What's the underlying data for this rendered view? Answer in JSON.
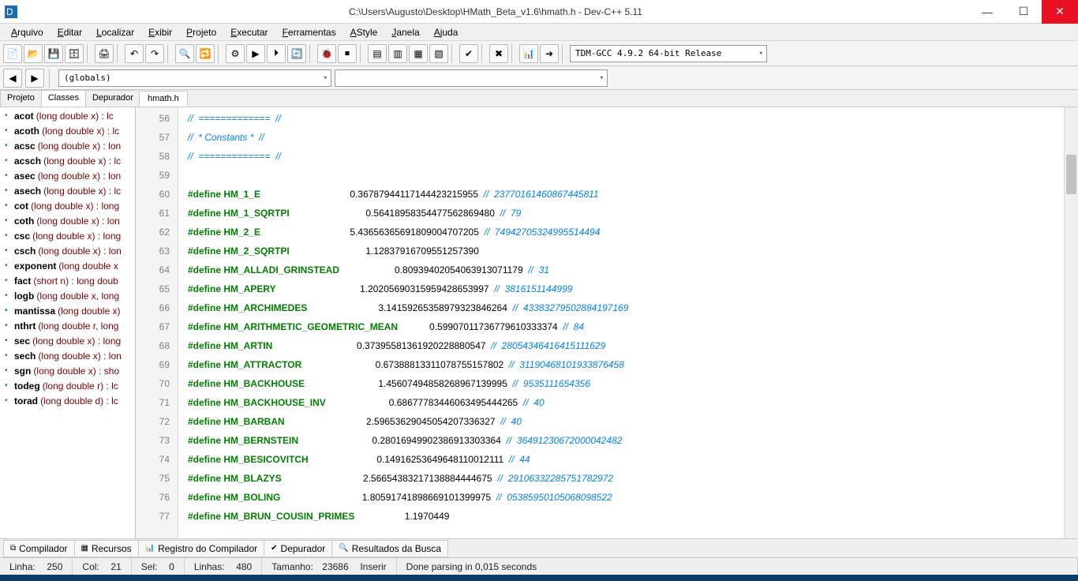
{
  "window": {
    "title": "C:\\Users\\Augusto\\Desktop\\HMath_Beta_v1.6\\hmath.h - Dev-C++ 5.11"
  },
  "menu": [
    "Arquivo",
    "Editar",
    "Localizar",
    "Exibir",
    "Projeto",
    "Executar",
    "Ferramentas",
    "AStyle",
    "Janela",
    "Ajuda"
  ],
  "compiler_selector": "TDM-GCC 4.9.2 64-bit Release",
  "scope_selector": "(globals)",
  "side_tabs": [
    "Projeto",
    "Classes",
    "Depurador"
  ],
  "side_tab_active": 1,
  "symbols": [
    {
      "fn": "acot",
      "sig": "(long double x)  : lc"
    },
    {
      "fn": "acoth",
      "sig": "(long double x)  : lc"
    },
    {
      "fn": "acsc",
      "sig": "(long double x)  : lon"
    },
    {
      "fn": "acsch",
      "sig": "(long double x)  : lc"
    },
    {
      "fn": "asec",
      "sig": "(long double x)  : lon"
    },
    {
      "fn": "asech",
      "sig": "(long double x)  : lc"
    },
    {
      "fn": "cot",
      "sig": "(long double x)  : long"
    },
    {
      "fn": "coth",
      "sig": "(long double x)  : lon"
    },
    {
      "fn": "csc",
      "sig": "(long double x)  : long"
    },
    {
      "fn": "csch",
      "sig": "(long double x)  : lon"
    },
    {
      "fn": "exponent",
      "sig": "(long double x"
    },
    {
      "fn": "fact",
      "sig": "(short n)  : long doub"
    },
    {
      "fn": "logb",
      "sig": "(long double x, long"
    },
    {
      "fn": "mantissa",
      "sig": "(long double x)"
    },
    {
      "fn": "nthrt",
      "sig": "(long double r, long"
    },
    {
      "fn": "sec",
      "sig": "(long double x)  : long"
    },
    {
      "fn": "sech",
      "sig": "(long double x)  : lon"
    },
    {
      "fn": "sgn",
      "sig": "(long double x)  : sho"
    },
    {
      "fn": "todeg",
      "sig": "(long double r)  : lc"
    },
    {
      "fn": "torad",
      "sig": "(long double d)  : lc"
    }
  ],
  "editor_tab": "hmath.h",
  "code": [
    {
      "n": 56,
      "t": "comment",
      "text": "//  =============  //"
    },
    {
      "n": 57,
      "t": "comment",
      "text": "//  * Constants *  //"
    },
    {
      "n": 58,
      "t": "comment",
      "text": "//  =============  //"
    },
    {
      "n": 59,
      "t": "blank",
      "text": ""
    },
    {
      "n": 60,
      "t": "def",
      "name": "HM_1_E",
      "val": "0.36787944117144423215955",
      "trail": "  //  23770161460867445811"
    },
    {
      "n": 61,
      "t": "def",
      "name": "HM_1_SQRTPI",
      "val": "0.56418958354477562869480",
      "trail": "  //  79"
    },
    {
      "n": 62,
      "t": "def",
      "name": "HM_2_E",
      "val": "5.43656365691809004707205",
      "trail": "  //  74942705324995514494"
    },
    {
      "n": 63,
      "t": "def",
      "name": "HM_2_SQRTPI",
      "val": "1.12837916709551257390",
      "trail": ""
    },
    {
      "n": 64,
      "t": "def",
      "name": "HM_ALLADI_GRINSTEAD",
      "val": "0.80939402054063913071179",
      "trail": "  //  31"
    },
    {
      "n": 65,
      "t": "def",
      "name": "HM_APERY",
      "val": "1.20205690315959428653997",
      "trail": "  //  3816151144999"
    },
    {
      "n": 66,
      "t": "def",
      "name": "HM_ARCHIMEDES",
      "val": "3.14159265358979323846264",
      "trail": "  //  43383279502884197169"
    },
    {
      "n": 67,
      "t": "def",
      "name": "HM_ARITHMETIC_GEOMETRIC_MEAN",
      "val": "0.59907011736779610333374",
      "trail": "  //  84"
    },
    {
      "n": 68,
      "t": "def",
      "name": "HM_ARTIN",
      "val": "0.37395581361920228880547",
      "trail": "  //  28054346416415111629"
    },
    {
      "n": 69,
      "t": "def",
      "name": "HM_ATTRACTOR",
      "val": "0.67388813311078755157802",
      "trail": "  //  31190468101933876458"
    },
    {
      "n": 70,
      "t": "def",
      "name": "HM_BACKHOUSE",
      "val": "1.45607494858268967139995",
      "trail": "  //  9535111654356"
    },
    {
      "n": 71,
      "t": "def",
      "name": "HM_BACKHOUSE_INV",
      "val": "0.68677783446063495444265",
      "trail": "  //  40"
    },
    {
      "n": 72,
      "t": "def",
      "name": "HM_BARBAN",
      "val": "2.59653629045054207336327",
      "trail": "  //  40"
    },
    {
      "n": 73,
      "t": "def",
      "name": "HM_BERNSTEIN",
      "val": "0.28016949902386913303364",
      "trail": "  //  36491230672000042482"
    },
    {
      "n": 74,
      "t": "def",
      "name": "HM_BESICOVITCH",
      "val": "0.14916253649648110012111",
      "trail": "  //  44"
    },
    {
      "n": 75,
      "t": "def",
      "name": "HM_BLAZYS",
      "val": "2.56654383217138884444675",
      "trail": "  //  29106332285751782972"
    },
    {
      "n": 76,
      "t": "def",
      "name": "HM_BOLING",
      "val": "1.80591741898669101399975",
      "trail": "  //  05385950105068098522"
    },
    {
      "n": 77,
      "t": "def",
      "name": "HM_BRUN_COUSIN_PRIMES",
      "val": "1.1970449",
      "trail": ""
    }
  ],
  "bottom_tabs": [
    {
      "icon": "⧉",
      "label": "Compilador"
    },
    {
      "icon": "▦",
      "label": "Recursos"
    },
    {
      "icon": "📊",
      "label": "Registro do Compilador"
    },
    {
      "icon": "✔",
      "label": "Depurador"
    },
    {
      "icon": "🔍",
      "label": "Resultados da Busca"
    }
  ],
  "status": {
    "linha_lbl": "Linha:",
    "linha": "250",
    "col_lbl": "Col:",
    "col": "21",
    "sel_lbl": "Sel:",
    "sel": "0",
    "linhas_lbl": "Linhas:",
    "linhas": "480",
    "tam_lbl": "Tamanho:",
    "tam": "23686",
    "mode": "Inserir",
    "parse": "Done parsing in 0,015 seconds"
  }
}
